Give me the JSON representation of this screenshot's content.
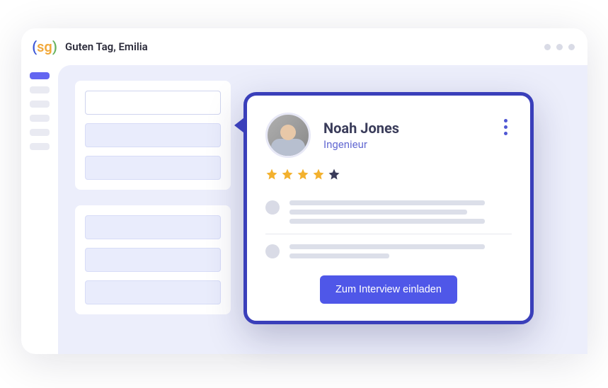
{
  "header": {
    "greeting": "Guten Tag, Emilia"
  },
  "candidate": {
    "name": "Noah Jones",
    "role": "Ingenieur",
    "rating": 4,
    "rating_max": 5,
    "cta_label": "Zum Interview einladen"
  }
}
